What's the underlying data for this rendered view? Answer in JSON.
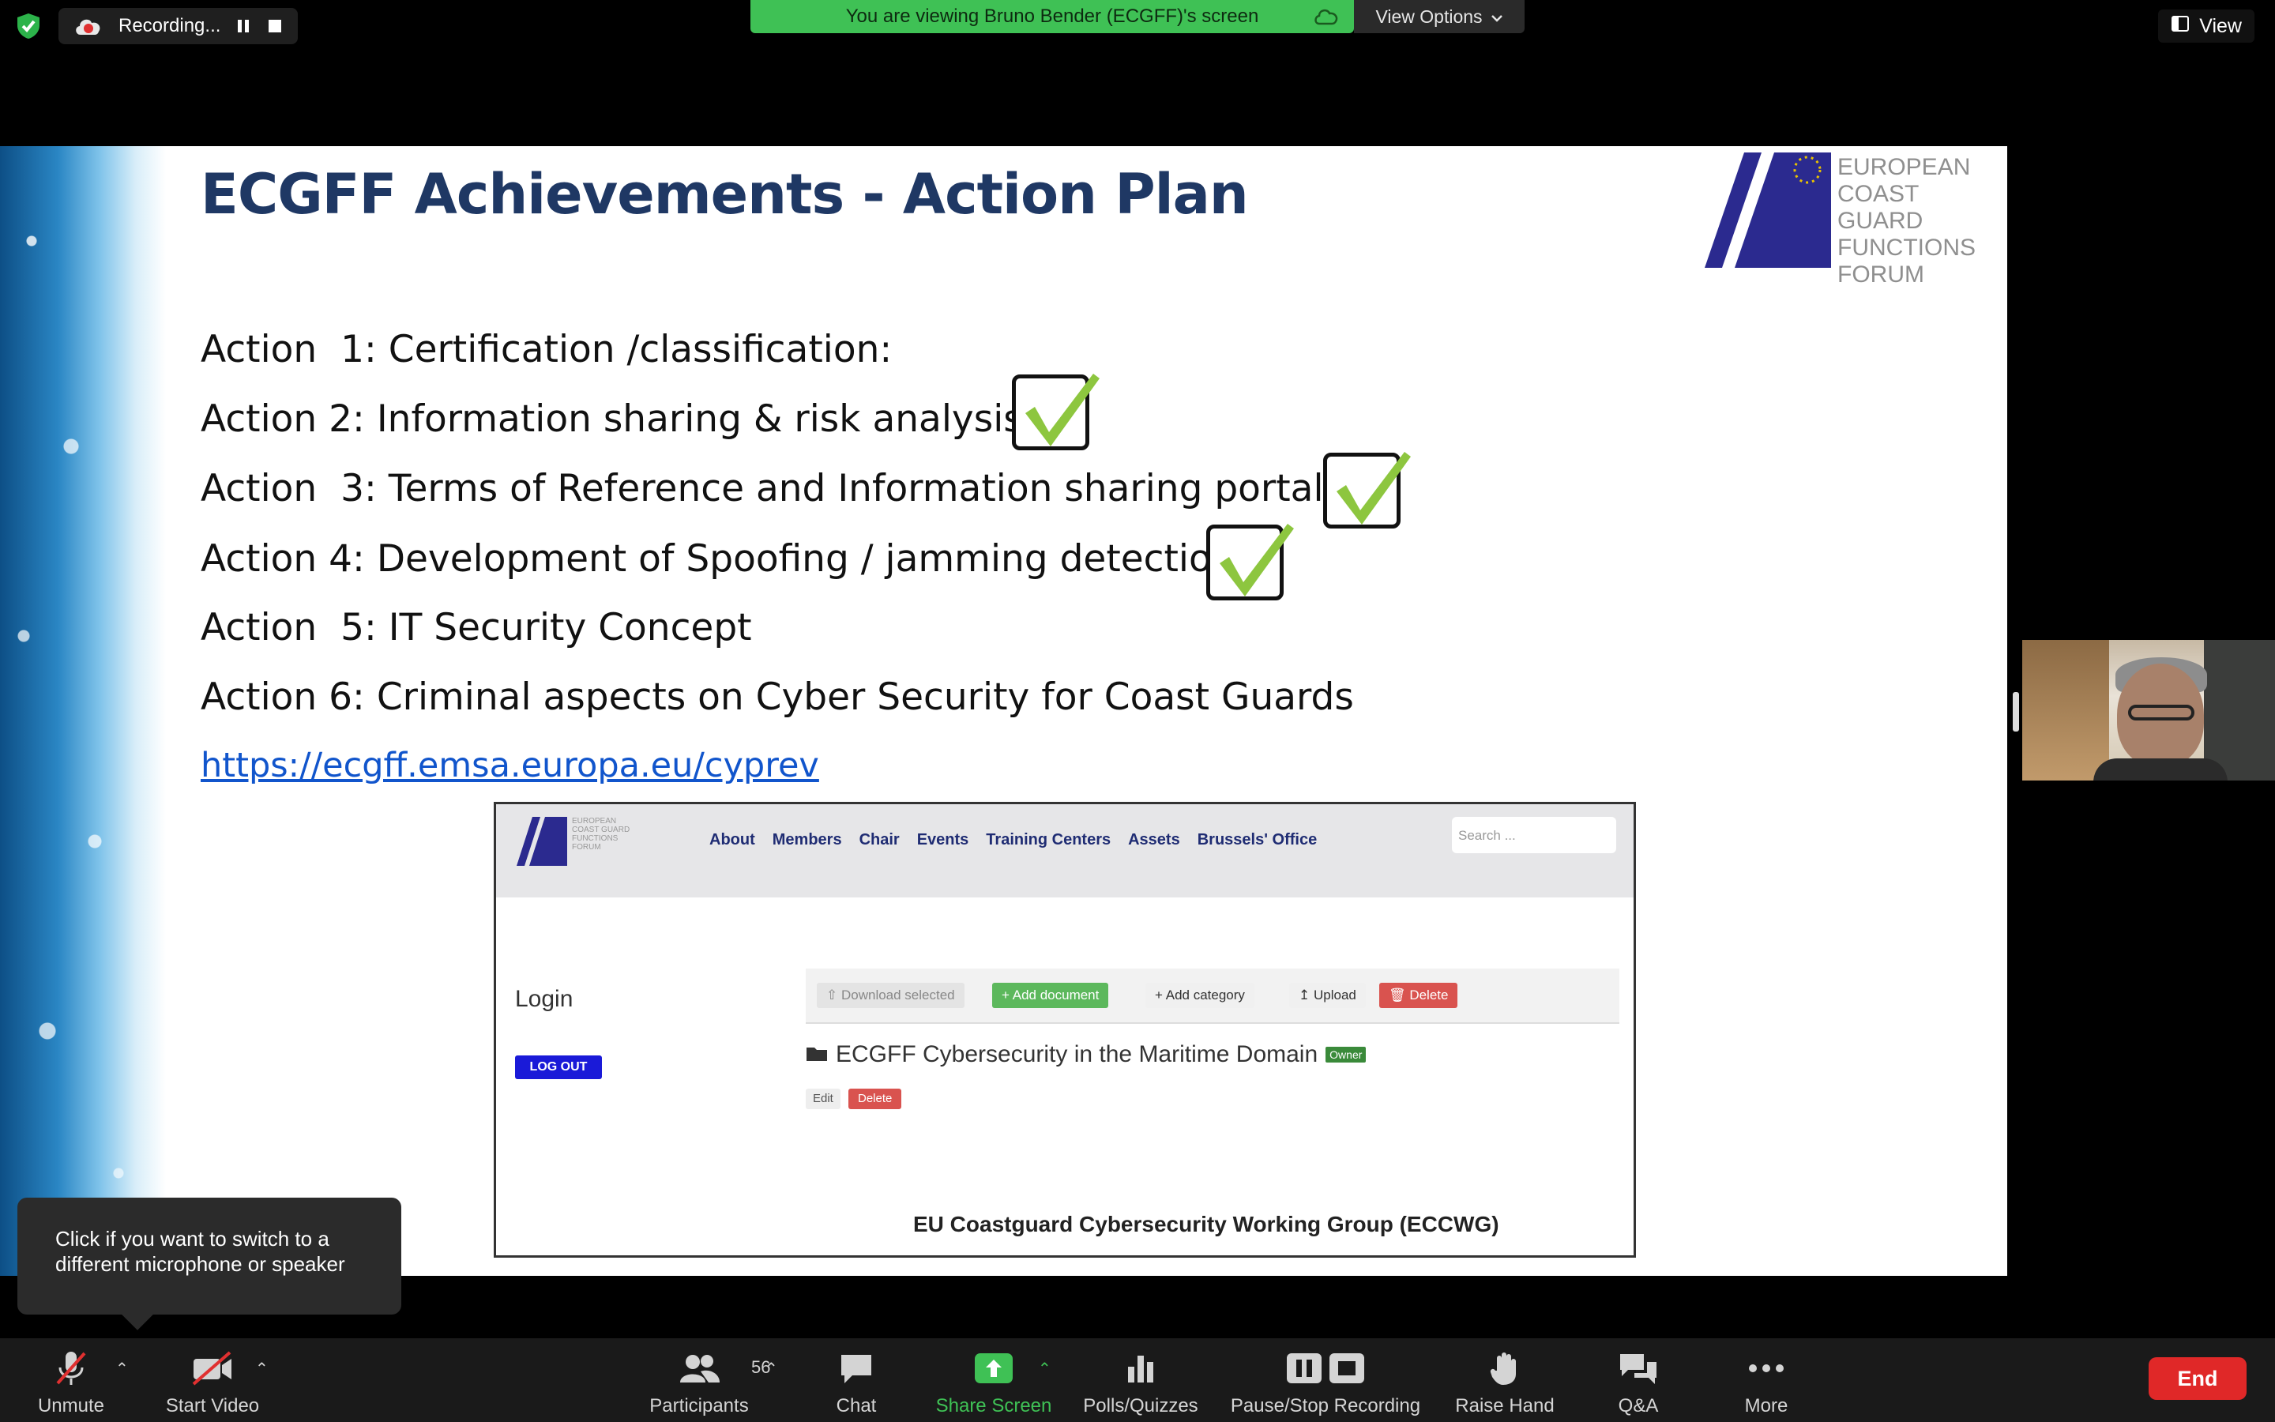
{
  "top": {
    "recording_label": "Recording...",
    "viewing_banner": "You are viewing Bruno Bender (ECGFF)'s screen",
    "view_options_label": "View Options",
    "view_label": "View"
  },
  "slide": {
    "title": "ECGFF Achievements - Action Plan",
    "logo_lines": [
      "EUROPEAN",
      "COAST GUARD",
      "FUNCTIONS",
      "FORUM"
    ],
    "actions": [
      {
        "text": "Action  1: Certification /classification:",
        "checked": false
      },
      {
        "text": "Action 2: Information sharing & risk analysis :",
        "checked": true
      },
      {
        "text": "Action  3: Terms of Reference and Information sharing portal :",
        "checked": true
      },
      {
        "text": "Action 4: Development of Spoofing / jamming detection",
        "checked": true
      },
      {
        "text": "Action  5: IT Security Concept",
        "checked": false
      },
      {
        "text": "Action 6: Criminal aspects on Cyber Security for Coast Guards",
        "checked": false
      }
    ],
    "link": "https://ecgff.emsa.europa.eu/cyprev",
    "check_color": "#8dc63f"
  },
  "portal": {
    "logo_lines": [
      "EUROPEAN",
      "COAST GUARD",
      "FUNCTIONS",
      "FORUM"
    ],
    "nav": [
      "About",
      "Members",
      "Chair",
      "Events",
      "Training Centers",
      "Assets",
      "Brussels' Office"
    ],
    "search_placeholder": "Search ...",
    "login_label": "Login",
    "logout_label": "LOG OUT",
    "toolbar": {
      "download": "Download selected",
      "add_document": "Add document",
      "add_category": "Add category",
      "upload": "Upload",
      "delete": "Delete"
    },
    "folder_name": "ECGFF Cybersecurity in the Maritime Domain",
    "owner_tag": "Owner",
    "edit": "Edit",
    "delete": "Delete",
    "footer": "EU Coastguard Cybersecurity Working Group (ECCWG)"
  },
  "tooltip": "Click if you want to switch to a different microphone or speaker",
  "toolbar": {
    "unmute": "Unmute",
    "start_video": "Start Video",
    "participants": "Participants",
    "participants_count": "56",
    "chat": "Chat",
    "share_screen": "Share Screen",
    "polls": "Polls/Quizzes",
    "pause_stop": "Pause/Stop Recording",
    "raise_hand": "Raise Hand",
    "qa": "Q&A",
    "more": "More",
    "end": "End"
  },
  "colors": {
    "banner_green": "#3fc155",
    "share_green": "#3fc155",
    "end_red": "#e02828",
    "slide_title": "#1f3864"
  }
}
